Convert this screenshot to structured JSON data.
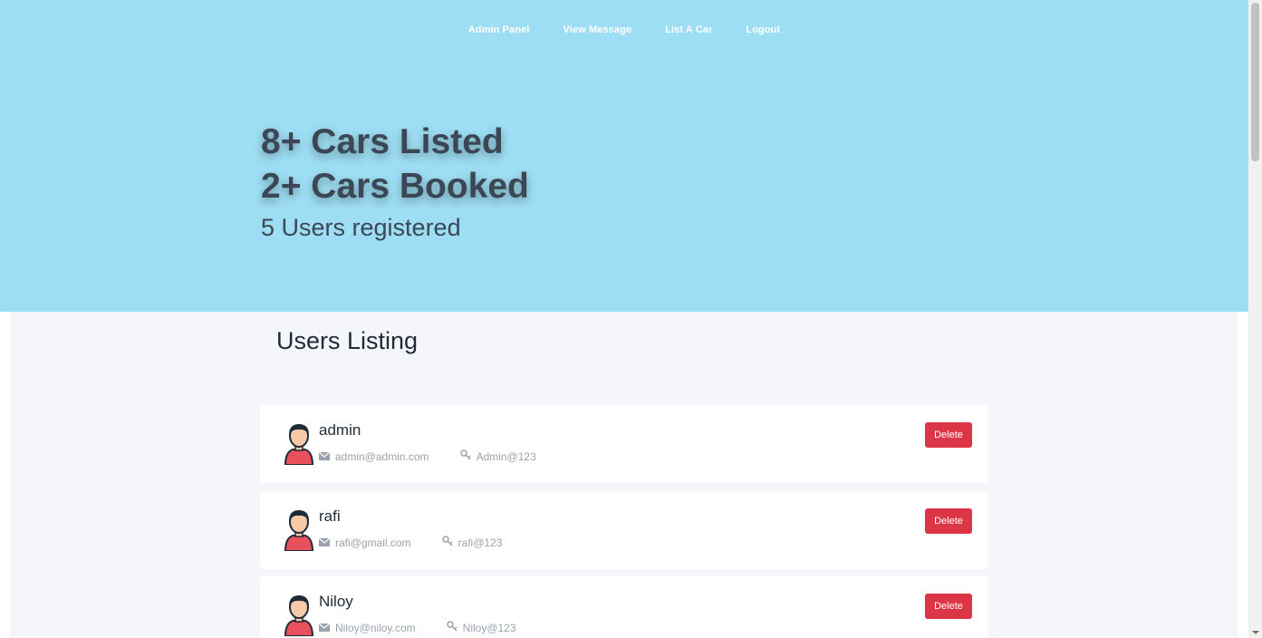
{
  "nav": {
    "items": [
      {
        "label": "Admin Panel"
      },
      {
        "label": "View Message"
      },
      {
        "label": "List A Car"
      },
      {
        "label": "Logout"
      }
    ]
  },
  "stats": {
    "cars_listed": "8+ Cars Listed",
    "cars_booked": "2+ Cars Booked",
    "users_registered": "5 Users registered"
  },
  "users_section": {
    "title": "Users Listing",
    "delete_label": "Delete",
    "users": [
      {
        "name": "admin",
        "email": "admin@admin.com",
        "password": "Admin@123"
      },
      {
        "name": "rafi",
        "email": "rafi@gmail.com",
        "password": "rafi@123"
      },
      {
        "name": "Niloy",
        "email": "Niloy@niloy.com",
        "password": "Niloy@123"
      }
    ]
  },
  "icons": {
    "email": "envelope-icon",
    "password": "key-icon",
    "avatar": "user-avatar-icon"
  },
  "colors": {
    "hero_bg": "#9edef4",
    "delete_button": "#dc3545",
    "content_bg": "#f4f6f9"
  }
}
